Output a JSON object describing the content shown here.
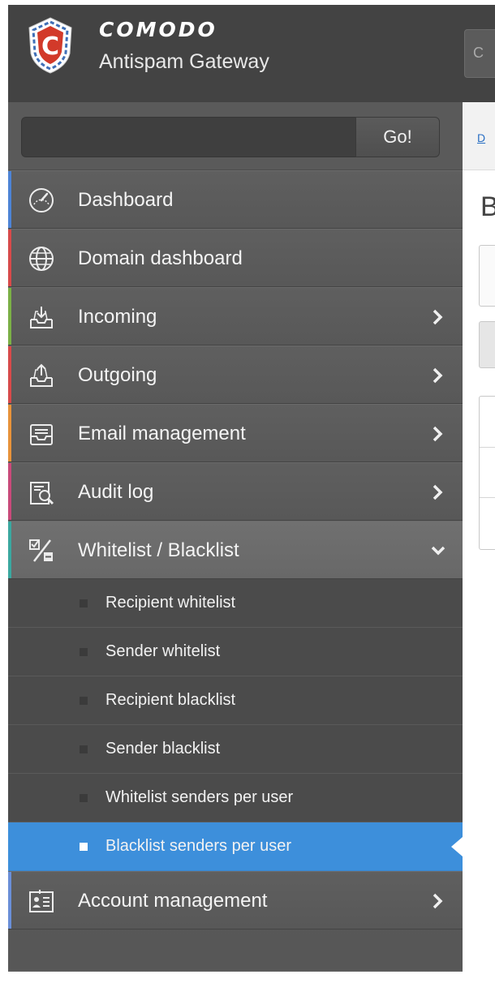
{
  "header": {
    "brand_name": "COMODO",
    "product_name": "Antispam Gateway",
    "top_button_stub": "C"
  },
  "search": {
    "value": "",
    "placeholder": "",
    "button_label": "Go!"
  },
  "colors": {
    "accent_dashboard": "#4d84d6",
    "accent_domain": "#d84a4a",
    "accent_incoming": "#7bb046",
    "accent_outgoing": "#d84a4a",
    "accent_email": "#e8933a",
    "accent_audit": "#c94a7a",
    "accent_whitelist": "#3aa8a0",
    "accent_account": "#6a8fd8",
    "selected_blue": "#3d8fdb"
  },
  "sidebar": {
    "items": [
      {
        "label": "Dashboard",
        "icon": "speedometer-icon",
        "has_arrow": false
      },
      {
        "label": "Domain dashboard",
        "icon": "globe-icon",
        "has_arrow": false
      },
      {
        "label": "Incoming",
        "icon": "inbox-in-icon",
        "has_arrow": true
      },
      {
        "label": "Outgoing",
        "icon": "inbox-out-icon",
        "has_arrow": true
      },
      {
        "label": "Email management",
        "icon": "mail-tray-icon",
        "has_arrow": true
      },
      {
        "label": "Audit log",
        "icon": "audit-search-icon",
        "has_arrow": true
      },
      {
        "label": "Whitelist / Blacklist",
        "icon": "whitelist-blacklist-icon",
        "has_arrow": true,
        "expanded": true
      },
      {
        "label": "Account management",
        "icon": "account-card-icon",
        "has_arrow": true
      }
    ],
    "subitems": [
      {
        "label": "Recipient whitelist",
        "selected": false
      },
      {
        "label": "Sender whitelist",
        "selected": false
      },
      {
        "label": "Recipient blacklist",
        "selected": false
      },
      {
        "label": "Sender blacklist",
        "selected": false
      },
      {
        "label": "Whitelist senders per user",
        "selected": false
      },
      {
        "label": "Blacklist senders per user",
        "selected": true
      }
    ]
  },
  "content": {
    "breadcrumb": "D",
    "title": "B"
  }
}
